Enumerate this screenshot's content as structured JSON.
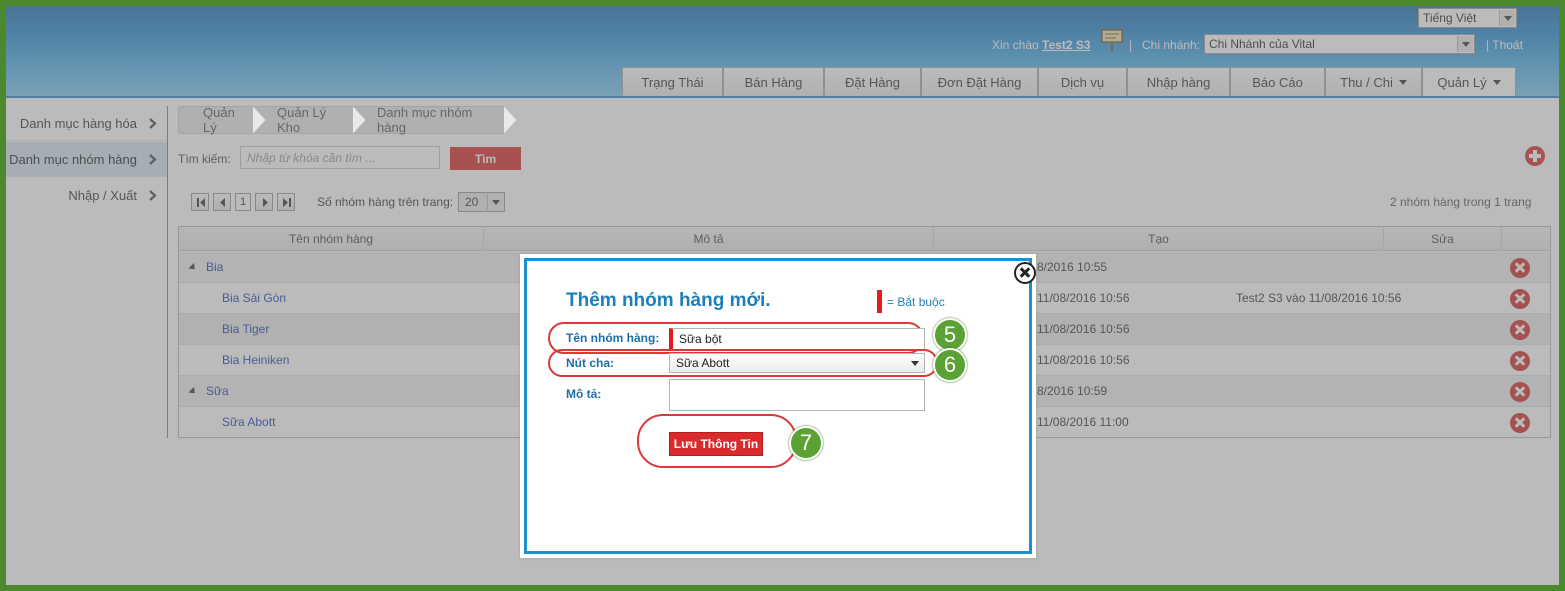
{
  "header": {
    "language": "Tiếng Việt",
    "greeting": "Xin chào",
    "username": "Test2 S3",
    "branch_label": "Chi nhánh:",
    "branch_value": "Chi Nhánh của Vital",
    "logout": "Thoát",
    "sep": "|"
  },
  "nav": {
    "tabs": [
      {
        "label": "Trạng Thái"
      },
      {
        "label": "Bán Hàng"
      },
      {
        "label": "Đặt Hàng"
      },
      {
        "label": "Đơn Đặt Hàng"
      },
      {
        "label": "Dịch vụ"
      },
      {
        "label": "Nhập hàng"
      },
      {
        "label": "Báo Cáo"
      },
      {
        "label": "Thu / Chi"
      },
      {
        "label": "Quản Lý"
      }
    ]
  },
  "sidebar": {
    "items": [
      {
        "label": "Danh mục hàng hóa"
      },
      {
        "label": "Danh mục nhóm hàng"
      },
      {
        "label": "Nhập / Xuất"
      }
    ]
  },
  "breadcrumb": [
    "Quản Lý",
    "Quản Lý Kho",
    "Danh mục nhóm hàng"
  ],
  "search": {
    "label": "Tìm kiếm:",
    "placeholder": "Nhập từ khóa cần tìm ...",
    "button": "Tìm"
  },
  "pager": {
    "current_page": "1",
    "page_size_label": "Số nhóm hàng trên trang:",
    "page_size": "20",
    "summary": "2 nhóm hàng trong 1 trang"
  },
  "table": {
    "columns": [
      "Tên nhóm hàng",
      "Mô tả",
      "Tạo",
      "Sửa"
    ],
    "rows": [
      {
        "name": "Bia",
        "created": "8/2016 10:55",
        "edited": ""
      },
      {
        "name": "Bia Sài Gòn",
        "created": "11/08/2016 10:56",
        "edited": "Test2 S3 vào 11/08/2016 10:56"
      },
      {
        "name": "Bia Tiger",
        "created": "11/08/2016 10:56",
        "edited": ""
      },
      {
        "name": "Bia Heiniken",
        "created": "11/08/2016 10:56",
        "edited": ""
      },
      {
        "name": "Sữa",
        "created": "8/2016 10:59",
        "edited": ""
      },
      {
        "name": "Sữa Abott",
        "created": "11/08/2016 11:00",
        "edited": ""
      }
    ]
  },
  "modal": {
    "title": "Thêm nhóm hàng mới.",
    "required_note": "= Bắt buộc",
    "name_label": "Tên nhóm hàng:",
    "name_value": "Sữa bột",
    "parent_label": "Nút cha:",
    "parent_value": "Sữa Abott",
    "desc_label": "Mô tả:",
    "desc_value": "",
    "save_button": "Lưu Thông Tin"
  },
  "steps": [
    "5",
    "6",
    "7"
  ],
  "colors": {
    "accent_red": "#d92b2b",
    "modal_border": "#1e8fcf",
    "step_green": "#5aa234"
  }
}
